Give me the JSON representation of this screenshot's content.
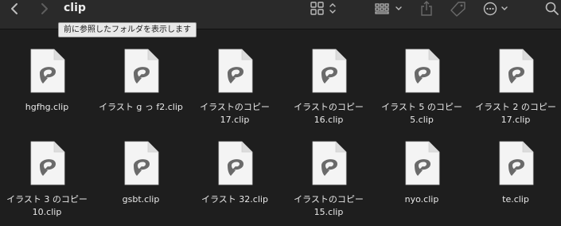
{
  "window": {
    "title": "clip",
    "tooltip": "前に参照したフォルダを表示します"
  },
  "toolbar": {
    "back_icon": "chevron-left-icon",
    "forward_icon": "chevron-right-icon",
    "view_icon": "grid-view-icon",
    "group_icon": "group-grid-icon",
    "share_icon": "share-icon",
    "tag_icon": "tag-icon",
    "more_icon": "ellipsis-circle-icon",
    "search_icon": "search-icon"
  },
  "files": [
    {
      "name": "hgfhg.clip"
    },
    {
      "name": "イラスト g っ f2.clip"
    },
    {
      "name": "イラストのコピー\n17.clip"
    },
    {
      "name": "イラストのコピー\n16.clip"
    },
    {
      "name": "イラスト 5 のコピー\n5.clip"
    },
    {
      "name": "イラスト 2 のコピー\n17.clip"
    },
    {
      "name": "イラスト 3 のコピー\n10.clip"
    },
    {
      "name": "gsbt.clip"
    },
    {
      "name": "イラスト 32.clip"
    },
    {
      "name": "イラストのコピー\n15.clip"
    },
    {
      "name": "nyo.clip"
    },
    {
      "name": "te.clip"
    }
  ],
  "colors": {
    "background": "#1e1e1e",
    "toolbar": "#2a2a2a",
    "doc_page": "#f4f4f4",
    "logo": "#6a6a6a"
  }
}
